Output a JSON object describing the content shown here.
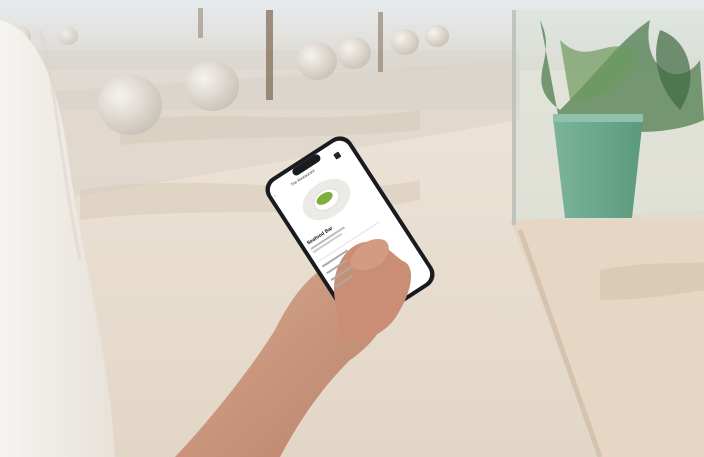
{
  "app": {
    "restaurant_name": "The Restaurant",
    "item_title": "Seafood Bar",
    "cart_icon": "cart-icon"
  },
  "scene_colors": {
    "pavement": "#e8ddd0",
    "sky_haze": "#e9eef2",
    "planter": "#6faa8f",
    "phone_body": "#1a1b1f",
    "screen": "#ffffff"
  },
  "icons": {
    "back": "chevron-left-icon",
    "close": "close-icon"
  }
}
